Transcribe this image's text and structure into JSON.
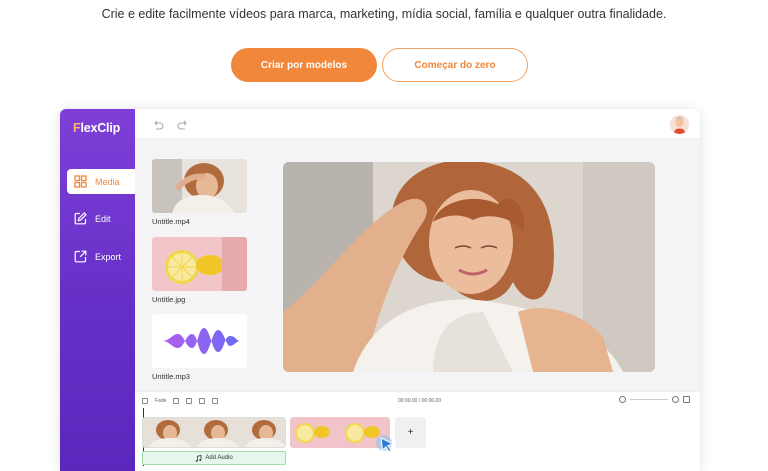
{
  "tagline": "Crie e edite facilmente vídeos para marca, marketing, mídia social, família e qualquer outra finalidade.",
  "buttons": {
    "templates": "Criar por modelos",
    "scratch": "Começar do zero"
  },
  "app": {
    "logo_first": "F",
    "logo_rest": "lexClip",
    "nav": [
      {
        "label": "Media",
        "icon": "grid-icon"
      },
      {
        "label": "Edit",
        "icon": "edit-icon"
      },
      {
        "label": "Export",
        "icon": "export-icon"
      }
    ],
    "media": [
      {
        "label": "Untitle.mp4"
      },
      {
        "label": "Untitle.jpg"
      },
      {
        "label": "Untitle.mp3"
      }
    ],
    "timeline": {
      "fade_label": "Fade",
      "timecode": "00:00.00 / 00:00.00",
      "add_clip": "+",
      "add_audio": "Add Audio"
    }
  },
  "colors": {
    "accent": "#f0873a",
    "sidebar": "#6a33cc"
  }
}
